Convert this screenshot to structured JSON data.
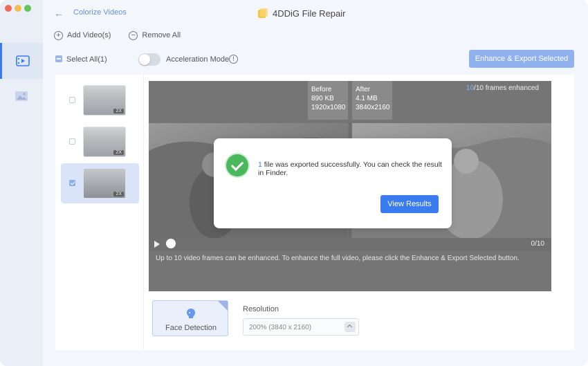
{
  "window": {
    "traffic_colors": [
      "#ee6a5f",
      "#f5bd4f",
      "#61c454"
    ]
  },
  "rail": {
    "items": [
      {
        "icon": "video-enhance-icon",
        "active": true
      },
      {
        "icon": "image-icon",
        "active": false
      }
    ]
  },
  "header": {
    "back_icon": "arrow-left-icon",
    "page_title": "Colorize Videos",
    "app_title": "4DDiG File Repair",
    "app_icon": "app-logo-icon"
  },
  "toolbar": {
    "add_label": "Add Video(s)",
    "remove_label": "Remove All"
  },
  "selection": {
    "select_all_label": "Select All(1)",
    "acceleration_label": "Acceleration Mode",
    "acceleration_on": false,
    "enhance_button": "Enhance & Export Selected"
  },
  "videos": [
    {
      "badge": "2X",
      "checked": false
    },
    {
      "badge": "2X",
      "checked": false
    },
    {
      "badge": "2X",
      "checked": true
    }
  ],
  "preview": {
    "frames_done": "10",
    "frames_suffix": "/10 frames enhanced",
    "before": {
      "label": "Before",
      "size": "890 KB",
      "resolution": "1920x1080"
    },
    "after": {
      "label": "After",
      "size": "4.1 MB",
      "resolution": "3840x2160"
    },
    "counter": "0/10",
    "progress": 0,
    "hint": "Up to 10 video frames can be enhanced. To enhance the full video, please click the Enhance & Export Selected button."
  },
  "options": {
    "face_detection_label": "Face Detection",
    "resolution_label": "Resolution",
    "resolution_value": "200% (3840 x 2160)"
  },
  "dialog": {
    "count": "1",
    "message": " file was exported successfully. You can check the result in Finder.",
    "button": "View Results"
  },
  "colors": {
    "accent": "#3a7bf0",
    "success": "#4cb85e"
  }
}
